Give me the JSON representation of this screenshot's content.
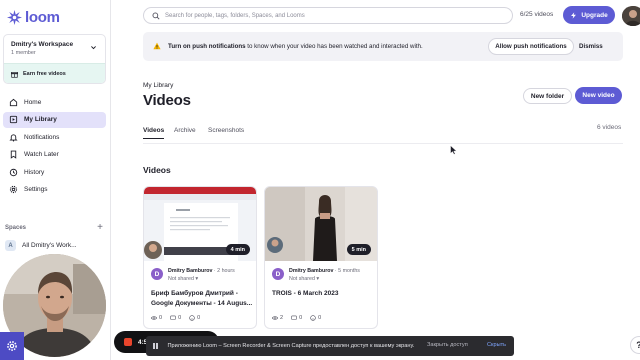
{
  "app": {
    "logo_text": "loom"
  },
  "colors": {
    "brand": "#5d5bd4",
    "banner_bg": "#f2f2f6",
    "earn_bg": "#e6f6f2",
    "active_nav": "#e3e1fa"
  },
  "workspace": {
    "name": "Dmitry's Workspace",
    "members": "1 member",
    "earn_label": "Earn free videos"
  },
  "sidebar": {
    "items": [
      {
        "label": "Home",
        "icon": "home-icon"
      },
      {
        "label": "My Library",
        "icon": "library-icon",
        "active": true
      },
      {
        "label": "Notifications",
        "icon": "bell-icon"
      },
      {
        "label": "Watch Later",
        "icon": "bookmark-icon"
      },
      {
        "label": "History",
        "icon": "history-icon"
      },
      {
        "label": "Settings",
        "icon": "gear-icon"
      }
    ],
    "spaces_title": "Spaces",
    "space": {
      "avatar": "A",
      "label": "All Dmitry's Work..."
    }
  },
  "topbar": {
    "search_placeholder": "Search for people, tags, folders, Spaces, and Looms",
    "video_counter": "6/25 videos",
    "upgrade_label": "Upgrade"
  },
  "banner": {
    "bold": "Turn on push notifications",
    "rest": " to know when your video has been watched and interacted with.",
    "allow_label": "Allow push notifications",
    "dismiss_label": "Dismiss"
  },
  "library": {
    "breadcrumb": "My Library",
    "title": "Videos",
    "new_folder_label": "New folder",
    "new_video_label": "New video",
    "tabs": [
      "Videos",
      "Archive",
      "Screenshots"
    ],
    "video_count": "6 videos",
    "section_title": "Videos"
  },
  "cards": [
    {
      "duration": "4 min",
      "avatar": "D",
      "owner": "Dmitry Bamburov",
      "ago": " · 2 hours",
      "share": "Not shared",
      "title": "Бриф Бамбуров Дмитрий - Google Документы - 14 Augus...",
      "views": "0",
      "comments": "0",
      "reactions": "0"
    },
    {
      "duration": "5 min",
      "avatar": "D",
      "owner": "Dmitry Bamburov",
      "ago": " · 5 months",
      "share": "Not shared",
      "title": "TROIS - 6 March 2023",
      "views": "2",
      "comments": "0",
      "reactions": "0"
    }
  ],
  "recorder": {
    "time": "4:5"
  },
  "sharebar": {
    "text": "Приложению Loom – Screen Recorder & Screen Capture предоставлен доступ к вашему экрану.",
    "stop_label": "Закрыть доступ",
    "hide_label": "Скрыть"
  },
  "help": {
    "label": "?"
  }
}
